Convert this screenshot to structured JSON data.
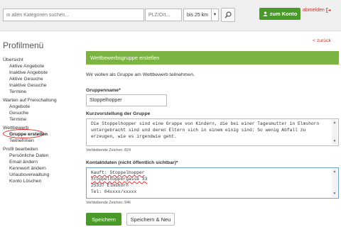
{
  "topbar": {
    "search_placeholder": "in allen Kategorien suchen...",
    "plz_placeholder": "PLZ/Ort...",
    "radius_value": "bis 25 km",
    "konto_label": "zum Konto",
    "logout_label": "abmelden"
  },
  "sidebar": {
    "title": "Profilmenü",
    "groups": [
      {
        "label": "Übersicht",
        "items": [
          "Aktive Angebote",
          "Inaktive Angebote",
          "Aktive Gesuche",
          "Inaktive Gesuche",
          "Termine"
        ]
      },
      {
        "label": "Warten auf Freischaltung",
        "items": [
          "Angebote",
          "Gesuche",
          "Termine"
        ]
      },
      {
        "label": "Wettbewerb",
        "items": [
          "Gruppe erstellen",
          "Teilnehmen"
        ]
      },
      {
        "label": "Profil bearbeiten",
        "items": [
          "Persönliche Daten",
          "Email ändern",
          "Kennwort ändern",
          "Urlaubsverwaltung",
          "Konto Löschen"
        ]
      }
    ],
    "active_item": "Gruppe erstellen"
  },
  "back_link": "< zurück",
  "main": {
    "header": "Wettbewerbsgruppe erstellen",
    "intro": "Wir wollen als Gruppe am Wettbewerb teilnehmen.",
    "group_name_label": "Gruppenname*",
    "group_name_value": "Stoppelhopper",
    "description_label": "Kurzvorstellung der Gruppe",
    "description_value": "Die Stoppelhopper sind eine Gruppe von Kindern, die bei einer Tagesmutter in Elmshorn untergebracht sind und deren Eltern sich in einem einig sind: So wenig Abfall zu erzeugen, wie es irgendwie geht.",
    "description_remaining": "Verbleibende Zeichen: 824",
    "contact_label": "Kontaktdaten (nicht öffentlich sichtbar)*",
    "contact_lines": [
      "Kauft: Stoppelhopper",
      "Stoppelhoppergasse 33",
      "25337 Elmshorn",
      "Tel: 04xxxx/xxxxx"
    ],
    "contact_remaining": "Verbleibende Zeichen: 946",
    "save_label": "Speichern",
    "save_new_label": "Speichern & Neu"
  },
  "colors": {
    "green": "#4a9a2a",
    "header_green": "#7cb342",
    "link_red": "#c0392b"
  }
}
